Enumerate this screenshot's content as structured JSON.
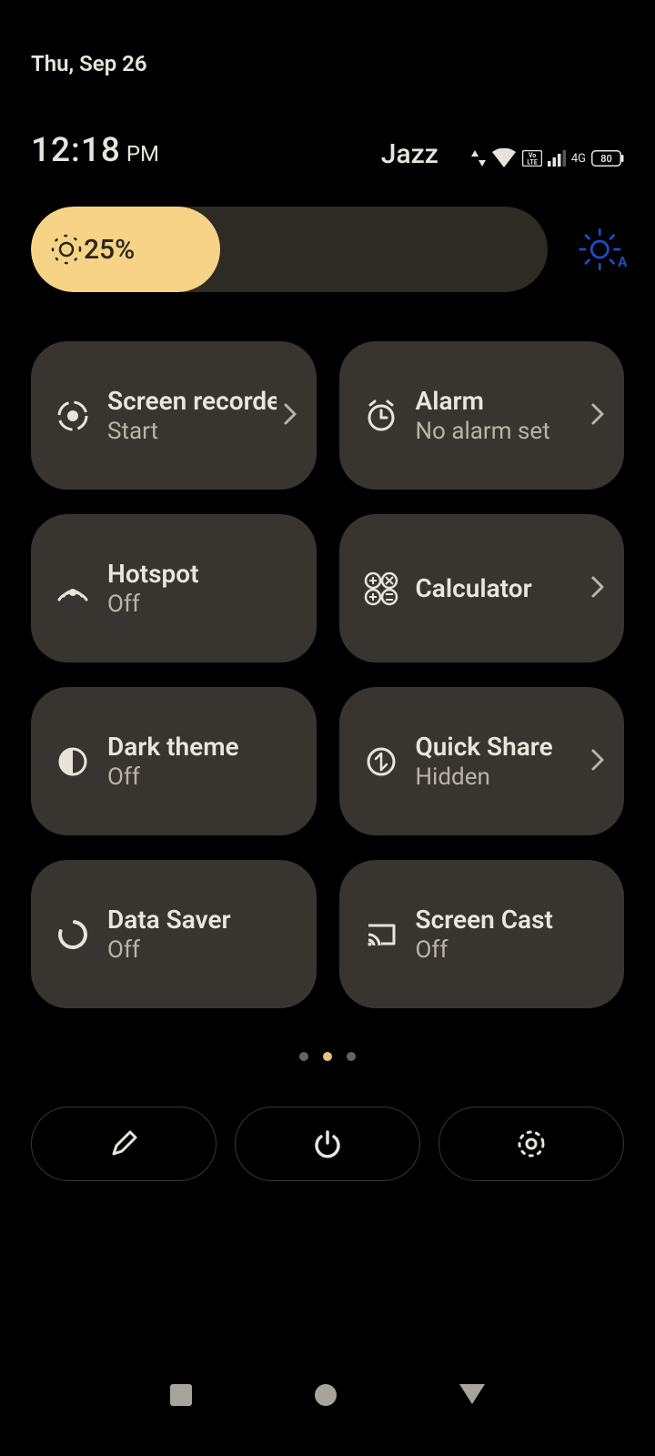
{
  "date": "Thu, Sep 26",
  "time": {
    "value": "12:18",
    "suffix": "PM"
  },
  "carrier": "Jazz",
  "status": {
    "network_type": "4G",
    "battery": "80",
    "volte": "VoLTE"
  },
  "brightness": {
    "percent_label": "25%"
  },
  "tiles": [
    {
      "title": "Screen recorder",
      "sub": "Start",
      "chevron": true,
      "icon": "record-icon"
    },
    {
      "title": "Alarm",
      "sub": "No alarm set",
      "chevron": true,
      "icon": "alarm-icon"
    },
    {
      "title": "Hotspot",
      "sub": "Off",
      "chevron": false,
      "icon": "hotspot-icon"
    },
    {
      "title": "Calculator",
      "sub": "",
      "chevron": true,
      "icon": "calculator-icon"
    },
    {
      "title": "Dark theme",
      "sub": "Off",
      "chevron": false,
      "icon": "dark-theme-icon"
    },
    {
      "title": "Quick Share",
      "sub": "Hidden",
      "chevron": true,
      "icon": "quick-share-icon"
    },
    {
      "title": "Data Saver",
      "sub": "Off",
      "chevron": false,
      "icon": "data-saver-icon"
    },
    {
      "title": "Screen Cast",
      "sub": "Off",
      "chevron": false,
      "icon": "cast-icon"
    }
  ],
  "page_dots": {
    "count": 3,
    "active": 1
  }
}
